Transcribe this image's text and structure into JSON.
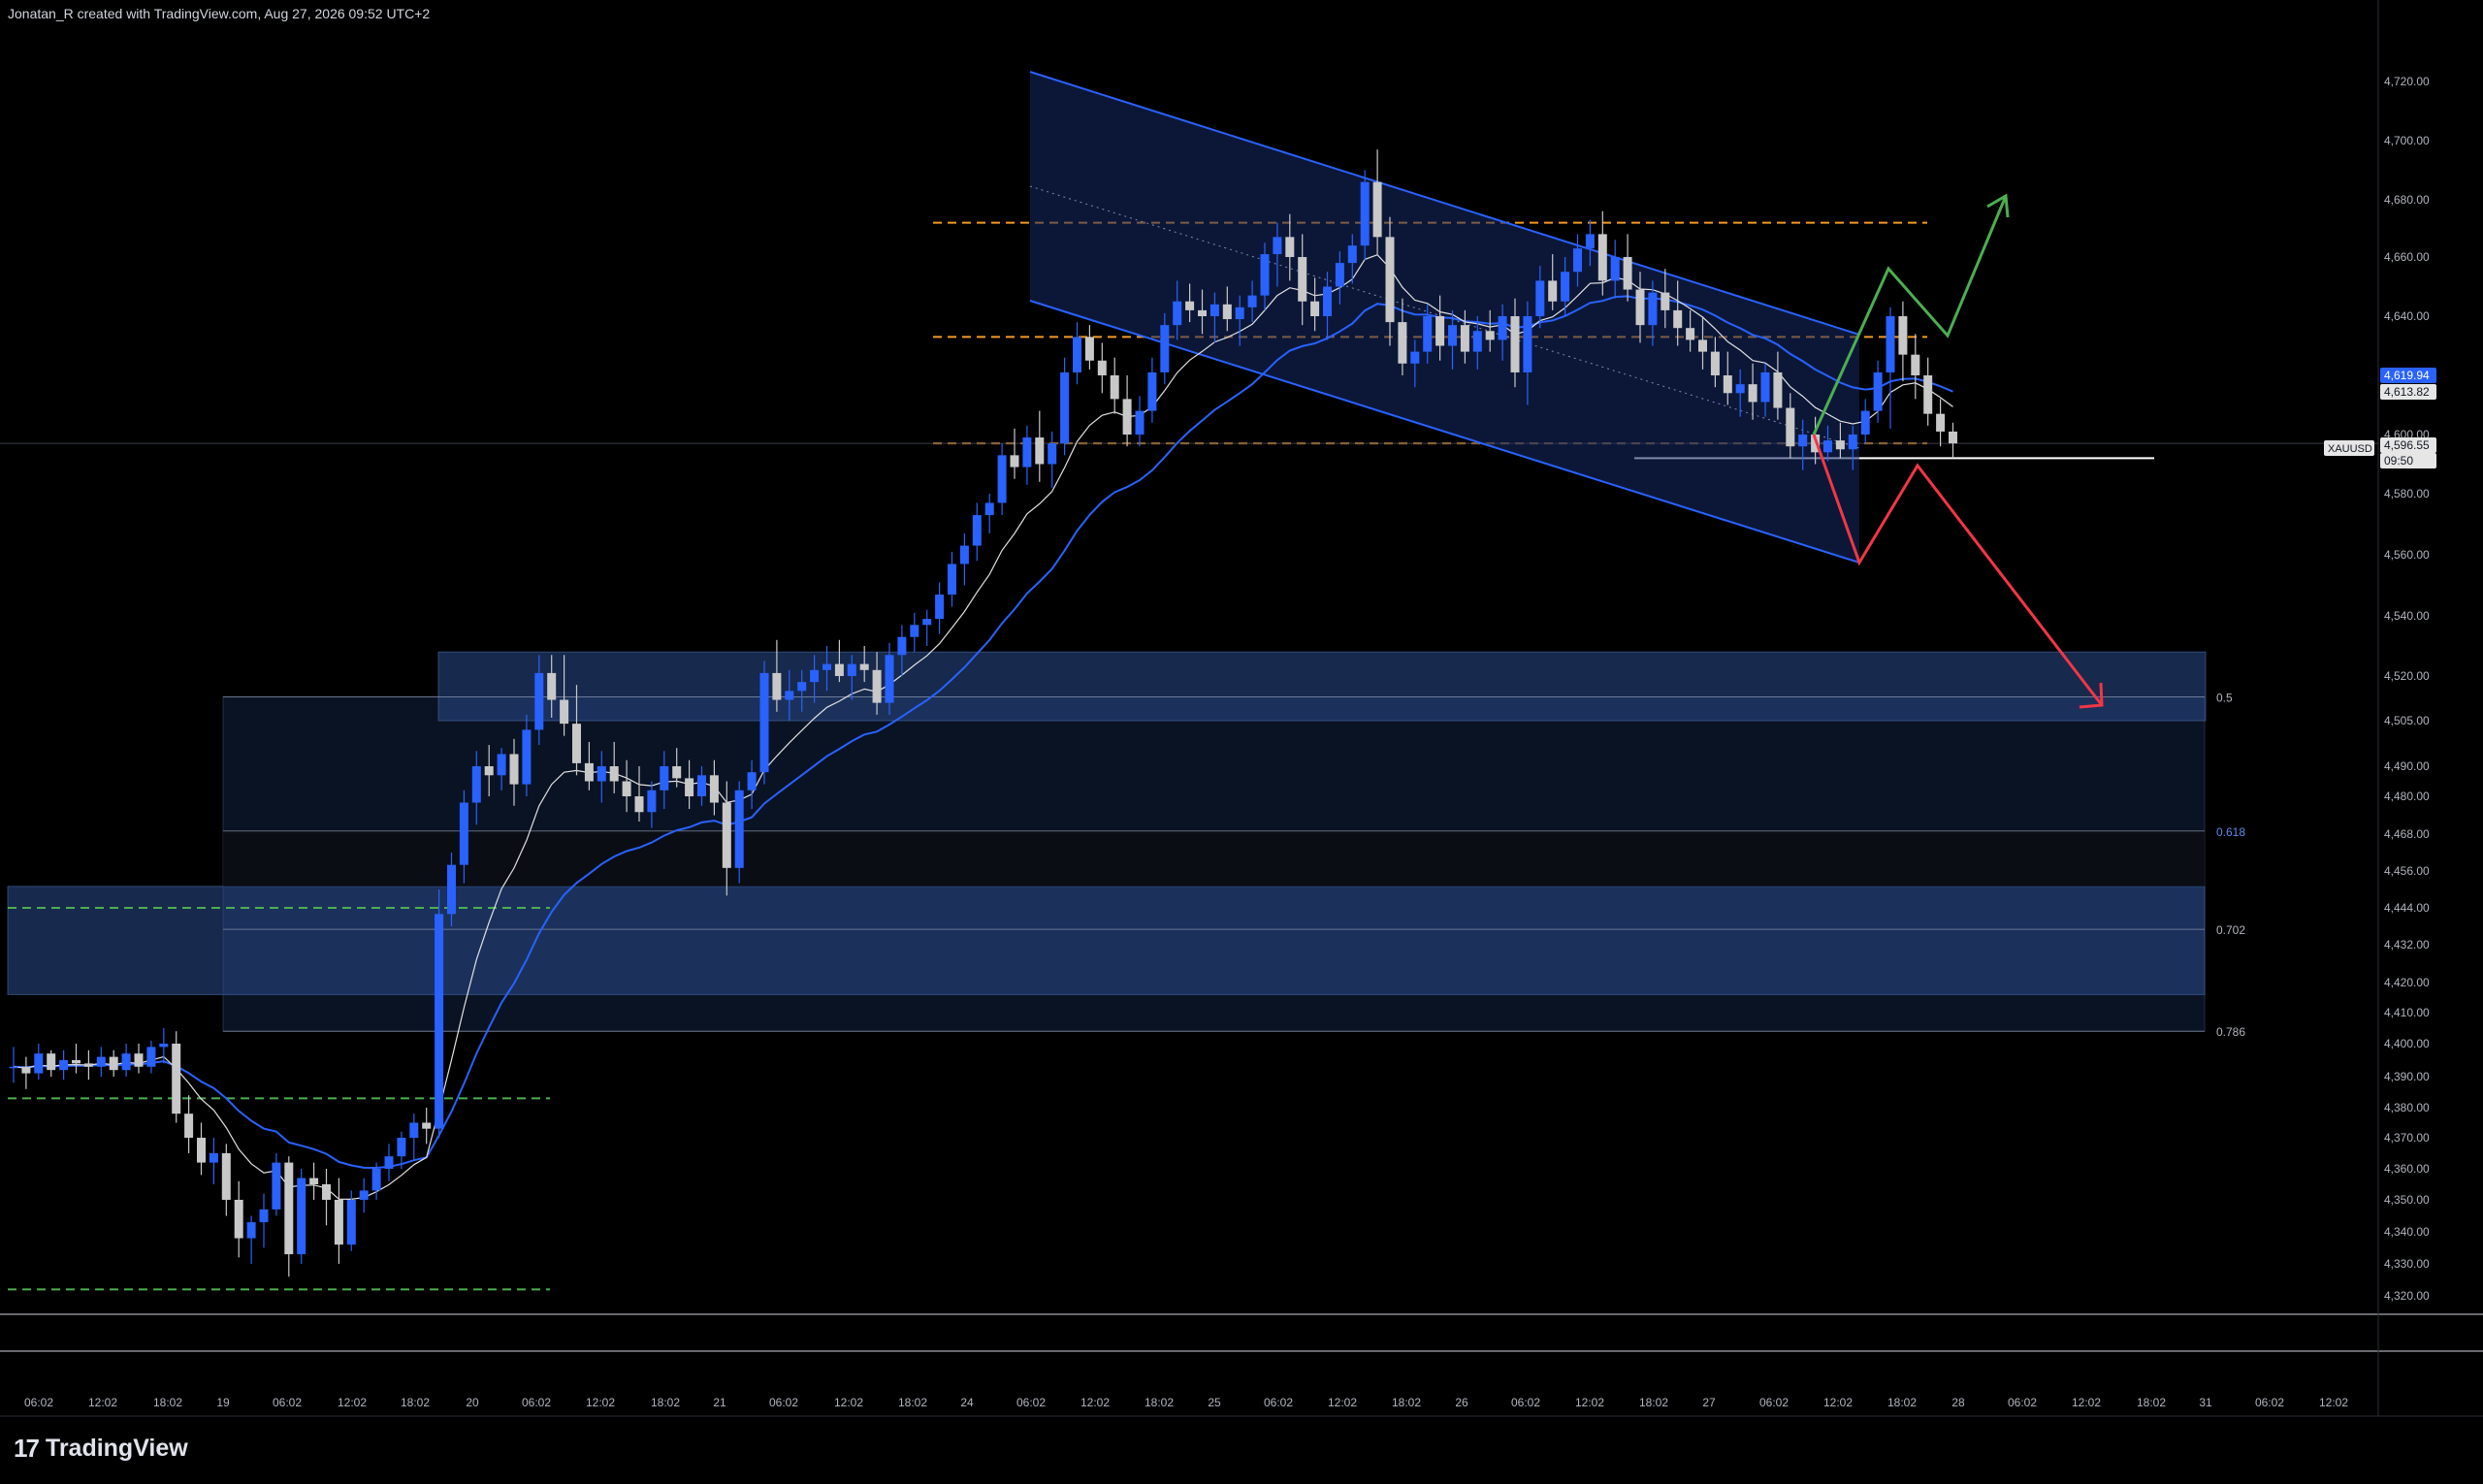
{
  "header": {
    "text": "Jonatan_R created with TradingView.com, Aug 27, 2026 09:52 UTC+2"
  },
  "branding": {
    "logo_text": "TradingView",
    "logo_glyph": "17"
  },
  "colors": {
    "background": "#000000",
    "bull_candle": "#2962ff",
    "bear_candle": "#c8c8c8",
    "ema_fast": "#e0e0e0",
    "ema_slow": "#2962ff",
    "channel": "#2962ff",
    "level_orange": "#f59a23",
    "level_green": "#4caf50",
    "arrow_up": "#4caf50",
    "arrow_down": "#f23645",
    "zone": "#1e3a70"
  },
  "chart_data": {
    "type": "candlestick",
    "symbol": "XAUUSD",
    "y_ticks": [
      4720,
      4700,
      4680,
      4660,
      4640,
      4620,
      4600,
      4580,
      4560,
      4540,
      4520,
      4505,
      4490,
      4480,
      4468,
      4456,
      4444,
      4432,
      4420,
      4410,
      4400,
      4390,
      4380,
      4370,
      4360,
      4350,
      4340,
      4330,
      4320
    ],
    "x_ticks": [
      "06:02",
      "12:02",
      "18:02",
      "19",
      "06:02",
      "12:02",
      "18:02",
      "20",
      "06:02",
      "12:02",
      "18:02",
      "21",
      "06:02",
      "12:02",
      "18:02",
      "24",
      "06:02",
      "12:02",
      "18:02",
      "25",
      "06:02",
      "12:02",
      "18:02",
      "26",
      "06:02",
      "12:02",
      "18:02",
      "27",
      "06:02",
      "12:02",
      "18:02",
      "28",
      "06:02",
      "12:02",
      "18:02",
      "31",
      "06:02",
      "12:02"
    ],
    "price_labels": [
      {
        "text": "4,619.94",
        "value": 4619.94,
        "style": "blue"
      },
      {
        "text": "4,613.82",
        "value": 4613.82,
        "style": "white"
      },
      {
        "text": "4,596.55",
        "value": 4596.55,
        "style": "white"
      },
      {
        "text": "09:50",
        "value": 4590,
        "style": "white"
      }
    ],
    "symbol_tag": {
      "text": "XAUUSD",
      "value": 4597
    },
    "fib_levels": [
      {
        "label": "0.5",
        "value": 4513
      },
      {
        "label": "0.618",
        "value": 4469
      },
      {
        "label": "0.702",
        "value": 4437
      },
      {
        "label": "0.786",
        "value": 4404
      }
    ],
    "candles": [
      [
        4393,
        4399,
        4388,
        4393
      ],
      [
        4393,
        4396,
        4386,
        4391
      ],
      [
        4391,
        4400,
        4389,
        4397
      ],
      [
        4397,
        4398,
        4390,
        4392
      ],
      [
        4392,
        4398,
        4389,
        4395
      ],
      [
        4395,
        4400,
        4391,
        4394
      ],
      [
        4394,
        4398,
        4389,
        4393
      ],
      [
        4393,
        4399,
        4390,
        4396
      ],
      [
        4396,
        4398,
        4390,
        4392
      ],
      [
        4392,
        4400,
        4390,
        4397
      ],
      [
        4397,
        4400,
        4391,
        4393
      ],
      [
        4393,
        4401,
        4391,
        4399
      ],
      [
        4399,
        4405,
        4394,
        4400
      ],
      [
        4400,
        4404,
        4375,
        4378
      ],
      [
        4378,
        4384,
        4365,
        4370
      ],
      [
        4370,
        4375,
        4358,
        4362
      ],
      [
        4362,
        4370,
        4355,
        4365
      ],
      [
        4365,
        4368,
        4345,
        4350
      ],
      [
        4350,
        4356,
        4332,
        4338
      ],
      [
        4338,
        4345,
        4330,
        4343
      ],
      [
        4343,
        4352,
        4335,
        4347
      ],
      [
        4347,
        4365,
        4345,
        4362
      ],
      [
        4362,
        4364,
        4326,
        4333
      ],
      [
        4333,
        4360,
        4330,
        4357
      ],
      [
        4357,
        4362,
        4350,
        4355
      ],
      [
        4355,
        4360,
        4342,
        4350
      ],
      [
        4350,
        4357,
        4330,
        4336
      ],
      [
        4336,
        4353,
        4334,
        4350
      ],
      [
        4350,
        4357,
        4346,
        4353
      ],
      [
        4353,
        4362,
        4350,
        4360
      ],
      [
        4360,
        4368,
        4356,
        4364
      ],
      [
        4364,
        4372,
        4360,
        4370
      ],
      [
        4370,
        4378,
        4363,
        4375
      ],
      [
        4375,
        4380,
        4368,
        4373
      ],
      [
        4373,
        4450,
        4370,
        4442
      ],
      [
        4442,
        4462,
        4438,
        4458
      ],
      [
        4458,
        4482,
        4452,
        4478
      ],
      [
        4478,
        4495,
        4471,
        4490
      ],
      [
        4490,
        4497,
        4480,
        4487
      ],
      [
        4487,
        4496,
        4482,
        4494
      ],
      [
        4494,
        4499,
        4477,
        4484
      ],
      [
        4484,
        4507,
        4480,
        4502
      ],
      [
        4502,
        4527,
        4497,
        4521
      ],
      [
        4521,
        4527,
        4506,
        4512
      ],
      [
        4512,
        4527,
        4500,
        4504
      ],
      [
        4504,
        4517,
        4487,
        4491
      ],
      [
        4491,
        4498,
        4482,
        4485
      ],
      [
        4485,
        4495,
        4478,
        4490
      ],
      [
        4490,
        4498,
        4481,
        4485
      ],
      [
        4485,
        4492,
        4475,
        4480
      ],
      [
        4480,
        4490,
        4472,
        4475
      ],
      [
        4475,
        4485,
        4470,
        4482
      ],
      [
        4482,
        4495,
        4476,
        4490
      ],
      [
        4490,
        4496,
        4483,
        4486
      ],
      [
        4486,
        4492,
        4476,
        4480
      ],
      [
        4480,
        4490,
        4477,
        4487
      ],
      [
        4487,
        4492,
        4474,
        4478
      ],
      [
        4478,
        4485,
        4448,
        4457
      ],
      [
        4457,
        4485,
        4452,
        4482
      ],
      [
        4482,
        4492,
        4476,
        4488
      ],
      [
        4488,
        4525,
        4484,
        4521
      ],
      [
        4521,
        4532,
        4508,
        4512
      ],
      [
        4512,
        4522,
        4505,
        4515
      ],
      [
        4515,
        4522,
        4508,
        4518
      ],
      [
        4518,
        4527,
        4511,
        4522
      ],
      [
        4522,
        4530,
        4515,
        4524
      ],
      [
        4524,
        4532,
        4518,
        4520
      ],
      [
        4520,
        4527,
        4512,
        4524
      ],
      [
        4524,
        4530,
        4518,
        4522
      ],
      [
        4522,
        4528,
        4507,
        4511
      ],
      [
        4511,
        4531,
        4507,
        4527
      ],
      [
        4527,
        4537,
        4520,
        4533
      ],
      [
        4533,
        4541,
        4528,
        4537
      ],
      [
        4537,
        4542,
        4530,
        4539
      ],
      [
        4539,
        4551,
        4534,
        4547
      ],
      [
        4547,
        4561,
        4543,
        4557
      ],
      [
        4557,
        4567,
        4550,
        4563
      ],
      [
        4563,
        4577,
        4558,
        4573
      ],
      [
        4573,
        4580,
        4567,
        4577
      ],
      [
        4577,
        4597,
        4573,
        4593
      ],
      [
        4593,
        4602,
        4585,
        4589
      ],
      [
        4589,
        4603,
        4583,
        4599
      ],
      [
        4599,
        4608,
        4584,
        4590
      ],
      [
        4590,
        4601,
        4582,
        4597
      ],
      [
        4597,
        4626,
        4593,
        4621
      ],
      [
        4621,
        4638,
        4617,
        4633
      ],
      [
        4633,
        4637,
        4622,
        4625
      ],
      [
        4625,
        4631,
        4614,
        4620
      ],
      [
        4620,
        4626,
        4607,
        4612
      ],
      [
        4612,
        4620,
        4596,
        4600
      ],
      [
        4600,
        4613,
        4596,
        4608
      ],
      [
        4608,
        4626,
        4604,
        4621
      ],
      [
        4621,
        4641,
        4617,
        4637
      ],
      [
        4637,
        4652,
        4632,
        4645
      ],
      [
        4645,
        4651,
        4638,
        4642
      ],
      [
        4642,
        4649,
        4634,
        4640
      ],
      [
        4640,
        4648,
        4631,
        4644
      ],
      [
        4644,
        4650,
        4635,
        4639
      ],
      [
        4639,
        4647,
        4630,
        4643
      ],
      [
        4643,
        4652,
        4638,
        4647
      ],
      [
        4647,
        4665,
        4642,
        4661
      ],
      [
        4661,
        4672,
        4650,
        4667
      ],
      [
        4667,
        4675,
        4652,
        4660
      ],
      [
        4660,
        4668,
        4637,
        4645
      ],
      [
        4645,
        4653,
        4635,
        4640
      ],
      [
        4640,
        4655,
        4632,
        4650
      ],
      [
        4650,
        4662,
        4644,
        4658
      ],
      [
        4658,
        4668,
        4651,
        4664
      ],
      [
        4664,
        4690,
        4659,
        4686
      ],
      [
        4686,
        4697,
        4661,
        4667
      ],
      [
        4667,
        4674,
        4630,
        4638
      ],
      [
        4638,
        4646,
        4620,
        4624
      ],
      [
        4624,
        4632,
        4616,
        4628
      ],
      [
        4628,
        4644,
        4624,
        4640
      ],
      [
        4640,
        4647,
        4625,
        4630
      ],
      [
        4630,
        4642,
        4622,
        4637
      ],
      [
        4637,
        4642,
        4624,
        4628
      ],
      [
        4628,
        4640,
        4622,
        4635
      ],
      [
        4635,
        4642,
        4628,
        4632
      ],
      [
        4632,
        4644,
        4625,
        4640
      ],
      [
        4640,
        4646,
        4616,
        4621
      ],
      [
        4621,
        4645,
        4610,
        4640
      ],
      [
        4640,
        4657,
        4636,
        4652
      ],
      [
        4652,
        4661,
        4642,
        4645
      ],
      [
        4645,
        4660,
        4640,
        4655
      ],
      [
        4655,
        4668,
        4650,
        4663
      ],
      [
        4663,
        4673,
        4657,
        4668
      ],
      [
        4668,
        4676,
        4647,
        4652
      ],
      [
        4652,
        4666,
        4646,
        4660
      ],
      [
        4660,
        4668,
        4645,
        4649
      ],
      [
        4649,
        4655,
        4631,
        4637
      ],
      [
        4637,
        4652,
        4630,
        4648
      ],
      [
        4648,
        4656,
        4636,
        4642
      ],
      [
        4642,
        4652,
        4630,
        4636
      ],
      [
        4636,
        4642,
        4628,
        4632
      ],
      [
        4632,
        4640,
        4622,
        4628
      ],
      [
        4628,
        4633,
        4616,
        4620
      ],
      [
        4620,
        4628,
        4610,
        4614
      ],
      [
        4614,
        4622,
        4606,
        4617
      ],
      [
        4617,
        4624,
        4605,
        4611
      ],
      [
        4611,
        4624,
        4606,
        4621
      ],
      [
        4621,
        4628,
        4605,
        4609
      ],
      [
        4609,
        4614,
        4592,
        4596
      ],
      [
        4596,
        4605,
        4588,
        4600
      ],
      [
        4600,
        4606,
        4590,
        4594
      ],
      [
        4594,
        4603,
        4591,
        4598
      ],
      [
        4598,
        4604,
        4592,
        4595
      ],
      [
        4595,
        4603,
        4588,
        4600
      ],
      [
        4600,
        4612,
        4597,
        4608
      ],
      [
        4608,
        4625,
        4604,
        4621
      ],
      [
        4621,
        4643,
        4602,
        4640
      ],
      [
        4640,
        4645,
        4618,
        4627
      ],
      [
        4627,
        4634,
        4612,
        4620
      ],
      [
        4620,
        4626,
        4603,
        4607
      ],
      [
        4607,
        4612,
        4596,
        4601
      ],
      [
        4601,
        4604,
        4592,
        4597
      ]
    ]
  }
}
